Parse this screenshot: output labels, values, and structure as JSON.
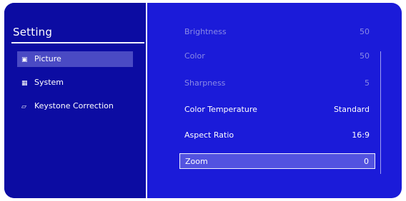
{
  "sidebar": {
    "title": "Setting",
    "items": [
      {
        "icon": "picture-icon",
        "glyph": "▣",
        "label": "Picture",
        "selected": true
      },
      {
        "icon": "system-icon",
        "glyph": "▦",
        "label": "System",
        "selected": false
      },
      {
        "icon": "keystone-icon",
        "glyph": "⏥",
        "label": "Keystone Correction",
        "selected": false
      }
    ]
  },
  "settings": [
    {
      "label": "Brightness",
      "value": "50",
      "enabled": false
    },
    {
      "label": "Color",
      "value": "50",
      "enabled": false
    },
    {
      "label": "Sharpness",
      "value": "5",
      "enabled": false
    },
    {
      "label": "Color Temperature",
      "value": "Standard",
      "enabled": true
    },
    {
      "label": "Aspect Ratio",
      "value": "16:9",
      "enabled": true
    },
    {
      "label": "Zoom",
      "value": "0",
      "enabled": true,
      "selected": true
    }
  ],
  "colors": {
    "osd_background": "#1b1bd9",
    "sidebar_background": "#0c0ca2",
    "selection": "#5353e0",
    "disabled_text": "#8a8ae6"
  }
}
